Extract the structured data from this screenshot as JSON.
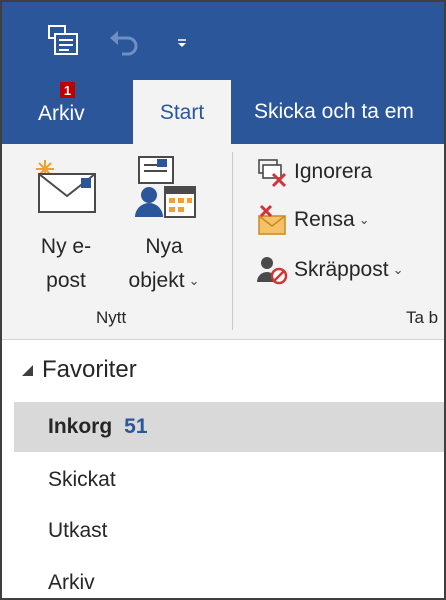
{
  "quick_access": {
    "save_icon": "save-send-receive-icon",
    "undo_icon": "undo-icon",
    "customize_icon": "customize-toolbar-chevron-icon"
  },
  "tabs": [
    {
      "label": "Arkiv",
      "keytip": "1",
      "active": false
    },
    {
      "label": "Start",
      "active": true
    },
    {
      "label": "Skicka och ta em",
      "active": false
    }
  ],
  "ribbon": {
    "new_mail": {
      "line1": "Ny e-",
      "line2": "post",
      "icon": "new-email-icon"
    },
    "new_items": {
      "line1": "Nya",
      "line2": "objekt",
      "icon": "new-items-icon"
    },
    "group_new": "Nytt",
    "ignore": {
      "label": "Ignorera",
      "icon": "ignore-icon"
    },
    "clean": {
      "label": "Rensa",
      "icon": "clean-up-icon"
    },
    "junk": {
      "label": "Skräppost",
      "icon": "junk-icon"
    },
    "group_delete": "Ta b"
  },
  "folder_pane": {
    "section": "Favoriter",
    "folders": [
      {
        "name": "Inkorg",
        "count": "51",
        "selected": true
      },
      {
        "name": "Skickat",
        "count": "",
        "selected": false
      },
      {
        "name": "Utkast",
        "count": "",
        "selected": false
      },
      {
        "name": "Arkiv",
        "count": "",
        "selected": false
      }
    ]
  },
  "colors": {
    "accent": "#2b579a",
    "ribbon_bg": "#f3f3f3",
    "selected_bg": "#d9d9d9",
    "keytip_bg": "#c00000"
  }
}
